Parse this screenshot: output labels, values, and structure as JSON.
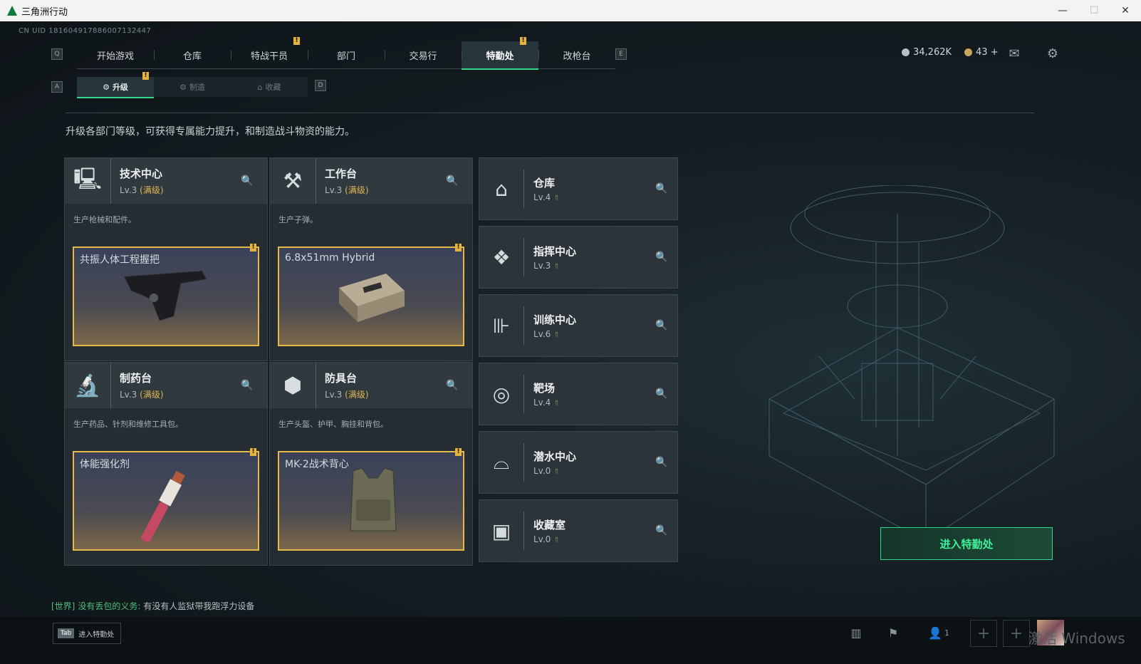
{
  "window": {
    "title": "三角洲行动"
  },
  "uid": "CN UID 181604917886007132447",
  "nav": {
    "key_left": "Q",
    "key_right": "E",
    "tabs": [
      {
        "label": "开始游戏"
      },
      {
        "label": "仓库"
      },
      {
        "label": "特战干员",
        "alert": "!"
      },
      {
        "label": "部门"
      },
      {
        "label": "交易行"
      },
      {
        "label": "特勤处",
        "alert": "!",
        "active": true
      },
      {
        "label": "改枪台"
      }
    ]
  },
  "resources": {
    "coins": "34,262K",
    "gold": "43 +"
  },
  "subnav": {
    "key_left": "A",
    "key_right": "D",
    "tabs": [
      {
        "label": "升级",
        "alert": "!",
        "active": true
      },
      {
        "label": "制造"
      },
      {
        "label": "收藏"
      }
    ]
  },
  "description": "升级各部门等级，可获得专属能力提升，和制造战斗物资的能力。",
  "facilities": [
    {
      "name": "技术中心",
      "level": "Lv.3",
      "max": "(满级)",
      "desc": "生产枪械和配件。",
      "product": "共振人体工程握把",
      "icon": "monitor-icon"
    },
    {
      "name": "工作台",
      "level": "Lv.3",
      "max": "(满级)",
      "desc": "生产子弹。",
      "product": "6.8x51mm Hybrid",
      "icon": "hammer-wrench-icon"
    },
    {
      "name": "制药台",
      "level": "Lv.3",
      "max": "(满级)",
      "desc": "生产药品、针剂和维修工具包。",
      "product": "体能强化剂",
      "icon": "microscope-icon"
    },
    {
      "name": "防具台",
      "level": "Lv.3",
      "max": "(满级)",
      "desc": "生产头盔、护甲、胸挂和背包。",
      "product": "MK-2战术背心",
      "icon": "boxes-icon"
    }
  ],
  "side_facilities": [
    {
      "name": "仓库",
      "level": "Lv.4",
      "icon": "warehouse-icon"
    },
    {
      "name": "指挥中心",
      "level": "Lv.3",
      "icon": "command-icon"
    },
    {
      "name": "训练中心",
      "level": "Lv.6",
      "icon": "dumbbell-icon"
    },
    {
      "name": "靶场",
      "level": "Lv.4",
      "icon": "target-icon"
    },
    {
      "name": "潜水中心",
      "level": "Lv.0",
      "icon": "diving-mask-icon"
    },
    {
      "name": "收藏室",
      "level": "Lv.0",
      "icon": "collection-icon"
    }
  ],
  "enter_button": "进入特勤处",
  "chat": {
    "channel": "[世界]",
    "user": "没有丢包的义务:",
    "message": "有没有人监狱带我跑浮力设备"
  },
  "bottom": {
    "tab_key": "Tab",
    "tab_label": "进入特勤处",
    "friends_count": "1",
    "watermark": "激活 Windows"
  },
  "colors": {
    "accent": "#2fd88a",
    "alert": "#e3b33b",
    "max_level": "#e0b453"
  }
}
